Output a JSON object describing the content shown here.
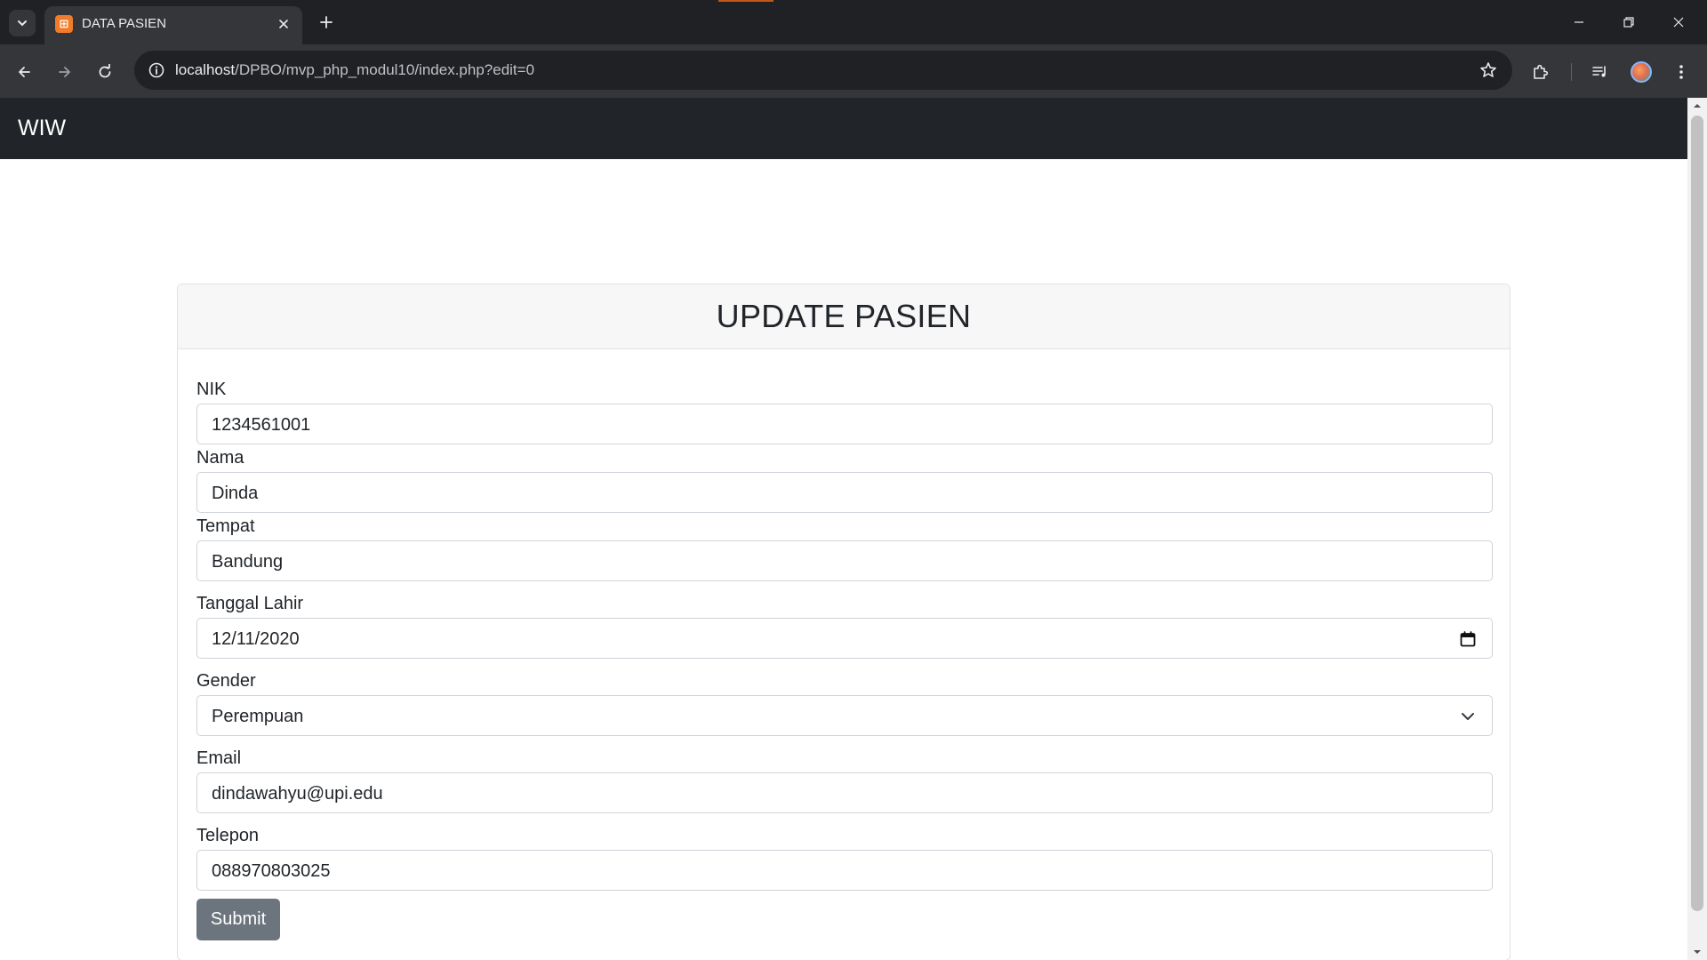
{
  "browser": {
    "tab_title": "DATA PASIEN",
    "favicon_glyph": "⊞",
    "url_host": "localhost",
    "url_path": "/DPBO/mvp_php_modul10/index.php?edit=0",
    "icons": {
      "tab_search": "chevron-down-icon",
      "close_tab": "close-icon",
      "new_tab": "plus-icon",
      "back": "arrow-left-icon",
      "forward": "arrow-right-icon",
      "reload": "reload-icon",
      "site_info": "info-icon",
      "bookmark": "star-icon",
      "extensions": "puzzle-icon",
      "media": "playlist-icon",
      "menu": "kebab-menu-icon"
    }
  },
  "navbar": {
    "brand": "WIW",
    "background": "#212529"
  },
  "form": {
    "title": "UPDATE PASIEN",
    "fields": [
      {
        "label": "NIK",
        "value": "1234561001"
      },
      {
        "label": "Nama",
        "value": "Dinda"
      },
      {
        "label": "Tempat",
        "value": "Bandung"
      },
      {
        "label": "Tanggal Lahir",
        "value": "12/11/2020"
      },
      {
        "label": "Gender",
        "value": "Perempuan"
      },
      {
        "label": "Email",
        "value": "dindawahyu@upi.edu"
      },
      {
        "label": "Telepon",
        "value": "088970803025"
      }
    ],
    "submit_label": "Submit",
    "submit_color": "#6c757d"
  }
}
